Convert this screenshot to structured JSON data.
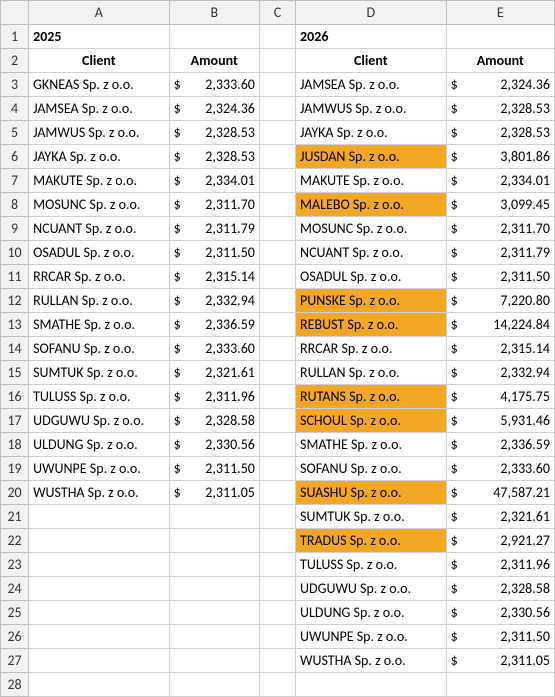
{
  "columns": [
    "A",
    "B",
    "C",
    "D",
    "E"
  ],
  "row_headers": [
    "1",
    "2",
    "3",
    "4",
    "5",
    "6",
    "7",
    "8",
    "9",
    "10",
    "11",
    "12",
    "13",
    "14",
    "15",
    "16",
    "17",
    "18",
    "19",
    "20",
    "21",
    "22",
    "23",
    "24",
    "25",
    "26",
    "27",
    "28"
  ],
  "year_left": "2025",
  "year_right": "2026",
  "headers": {
    "client": "Client",
    "amount": "Amount"
  },
  "currency": "$",
  "left": [
    {
      "client": "GKNEAS Sp. z o.o.",
      "amount": "2,333.60"
    },
    {
      "client": "JAMSEA Sp. z o.o.",
      "amount": "2,324.36"
    },
    {
      "client": "JAMWUS Sp. z o.o.",
      "amount": "2,328.53"
    },
    {
      "client": "JAYKA Sp. z o.o.",
      "amount": "2,328.53"
    },
    {
      "client": "MAKUTE Sp. z o.o.",
      "amount": "2,334.01"
    },
    {
      "client": "MOSUNC Sp. z o.o.",
      "amount": "2,311.70"
    },
    {
      "client": "NCUANT Sp. z o.o.",
      "amount": "2,311.79"
    },
    {
      "client": "OSADUL Sp. z o.o.",
      "amount": "2,311.50"
    },
    {
      "client": "RRCAR Sp. z o.o.",
      "amount": "2,315.14"
    },
    {
      "client": "RULLAN Sp. z o.o.",
      "amount": "2,332.94"
    },
    {
      "client": "SMATHE Sp. z o.o.",
      "amount": "2,336.59"
    },
    {
      "client": "SOFANU Sp. z o.o.",
      "amount": "2,333.60"
    },
    {
      "client": "SUMTUK Sp. z o.o.",
      "amount": "2,321.61"
    },
    {
      "client": "TULUSS Sp. z o.o.",
      "amount": "2,311.96"
    },
    {
      "client": "UDGUWU Sp. z o.o.",
      "amount": "2,328.58"
    },
    {
      "client": "ULDUNG Sp. z o.o.",
      "amount": "2,330.56"
    },
    {
      "client": "UWUNPE Sp. z o.o.",
      "amount": "2,311.50"
    },
    {
      "client": "WUSTHA Sp. z o.o.",
      "amount": "2,311.05"
    }
  ],
  "right": [
    {
      "client": "JAMSEA Sp. z o.o.",
      "amount": "2,324.36",
      "hl": false
    },
    {
      "client": "JAMWUS Sp. z o.o.",
      "amount": "2,328.53",
      "hl": false
    },
    {
      "client": "JAYKA Sp. z o.o.",
      "amount": "2,328.53",
      "hl": false
    },
    {
      "client": "JUSDAN Sp. z o.o.",
      "amount": "3,801.86",
      "hl": true
    },
    {
      "client": "MAKUTE Sp. z o.o.",
      "amount": "2,334.01",
      "hl": false
    },
    {
      "client": "MALEBO Sp. z o.o.",
      "amount": "3,099.45",
      "hl": true
    },
    {
      "client": "MOSUNC Sp. z o.o.",
      "amount": "2,311.70",
      "hl": false
    },
    {
      "client": "NCUANT Sp. z o.o.",
      "amount": "2,311.79",
      "hl": false
    },
    {
      "client": "OSADUL Sp. z o.o.",
      "amount": "2,311.50",
      "hl": false
    },
    {
      "client": "PUNSKE Sp. z o.o.",
      "amount": "7,220.80",
      "hl": true
    },
    {
      "client": "REBUST Sp. z o.o.",
      "amount": "14,224.84",
      "hl": true
    },
    {
      "client": "RRCAR Sp. z o.o.",
      "amount": "2,315.14",
      "hl": false
    },
    {
      "client": "RULLAN Sp. z o.o.",
      "amount": "2,332.94",
      "hl": false
    },
    {
      "client": "RUTANS Sp. z o.o.",
      "amount": "4,175.75",
      "hl": true
    },
    {
      "client": "SCHOUL Sp. z o.o.",
      "amount": "5,931.46",
      "hl": true
    },
    {
      "client": "SMATHE Sp. z o.o.",
      "amount": "2,336.59",
      "hl": false
    },
    {
      "client": "SOFANU Sp. z o.o.",
      "amount": "2,333.60",
      "hl": false
    },
    {
      "client": "SUASHU Sp. z o.o.",
      "amount": "47,587.21",
      "hl": true
    },
    {
      "client": "SUMTUK Sp. z o.o.",
      "amount": "2,321.61",
      "hl": false
    },
    {
      "client": "TRADUS Sp. z o.o.",
      "amount": "2,921.27",
      "hl": true
    },
    {
      "client": "TULUSS Sp. z o.o.",
      "amount": "2,311.96",
      "hl": false
    },
    {
      "client": "UDGUWU Sp. z o.o.",
      "amount": "2,328.58",
      "hl": false
    },
    {
      "client": "ULDUNG Sp. z o.o.",
      "amount": "2,330.56",
      "hl": false
    },
    {
      "client": "UWUNPE Sp. z o.o.",
      "amount": "2,311.50",
      "hl": false
    },
    {
      "client": "WUSTHA Sp. z o.o.",
      "amount": "2,311.05",
      "hl": false
    }
  ]
}
